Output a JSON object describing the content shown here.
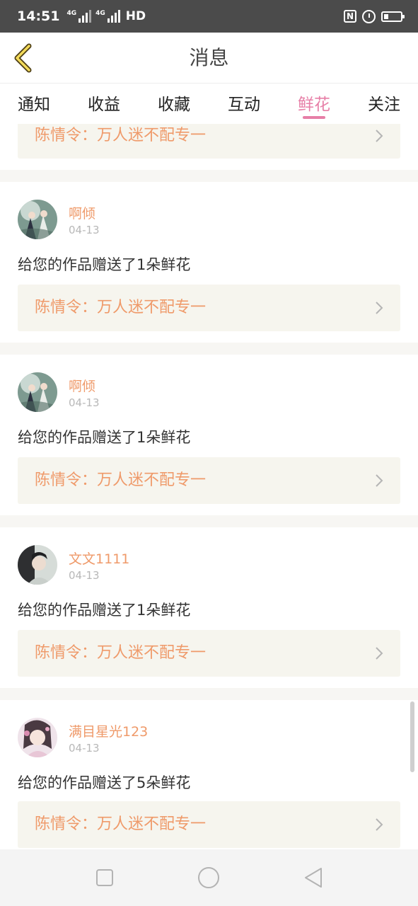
{
  "status_bar": {
    "time": "14:51",
    "signal1_label": "4G",
    "signal2_label": "4G",
    "network_label": "HD",
    "icons": [
      "nfc-icon",
      "alarm-icon",
      "battery-icon"
    ]
  },
  "header": {
    "title": "消息",
    "back_icon": "chevron-left-icon"
  },
  "tabs": [
    {
      "label": "通知",
      "active": false
    },
    {
      "label": "收益",
      "active": false
    },
    {
      "label": "收藏",
      "active": false
    },
    {
      "label": "互动",
      "active": false
    },
    {
      "label": "鲜花",
      "active": true
    },
    {
      "label": "关注",
      "active": false
    }
  ],
  "partial_top_card": {
    "work_title": "陈情令：万人迷不配专一"
  },
  "messages": [
    {
      "user": "啊倾",
      "date": "04-13",
      "text": "给您的作品赠送了1朵鲜花",
      "work_title": "陈情令：万人迷不配专一"
    },
    {
      "user": "啊倾",
      "date": "04-13",
      "text": "给您的作品赠送了1朵鲜花",
      "work_title": "陈情令：万人迷不配专一"
    },
    {
      "user": "文文1111",
      "date": "04-13",
      "text": "给您的作品赠送了1朵鲜花",
      "work_title": "陈情令：万人迷不配专一"
    },
    {
      "user": "满目星光123",
      "date": "04-13",
      "text": "给您的作品赠送了5朵鲜花",
      "work_title": "陈情令：万人迷不配专一"
    }
  ],
  "colors": {
    "accent_pink": "#e77fa7",
    "name_orange": "#ef9a6a",
    "link_bg": "#f6f5ee"
  },
  "nav_bar": {
    "icons": [
      "recents-square-icon",
      "home-circle-icon",
      "back-triangle-icon"
    ]
  }
}
